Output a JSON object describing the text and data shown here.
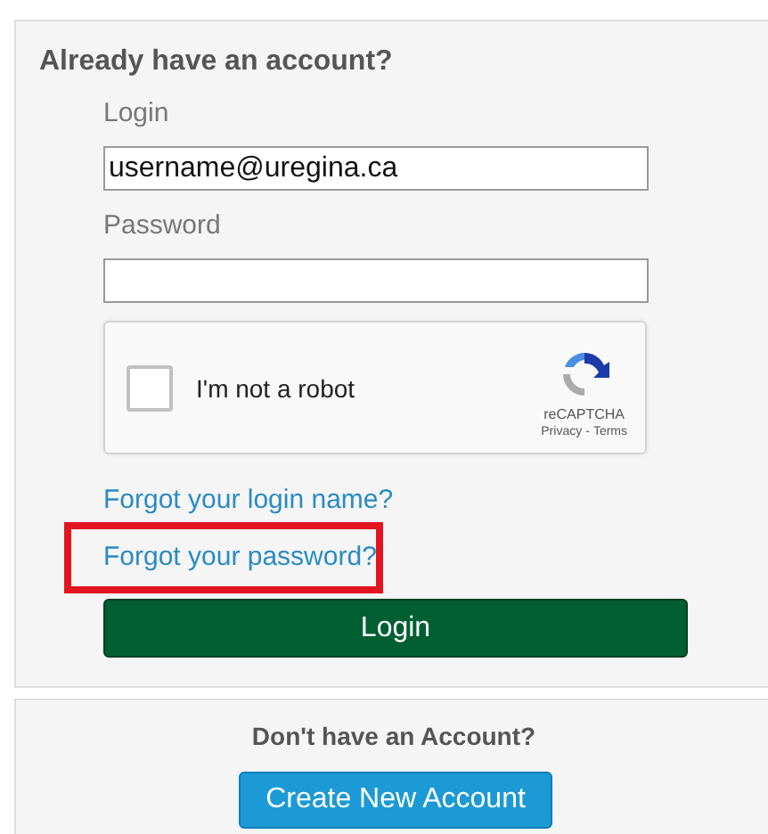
{
  "login_panel": {
    "title": "Already have an account?",
    "login_label": "Login",
    "login_value": "username@uregina.ca",
    "password_label": "Password",
    "captcha": {
      "checked": false,
      "label": "I'm not a robot",
      "brand": "reCAPTCHA",
      "privacy": "Privacy",
      "separator": "-",
      "terms": "Terms"
    },
    "links": [
      {
        "text": "Forgot your login name?",
        "highlighted": false
      },
      {
        "text": "Forgot your password?",
        "highlighted": true
      }
    ],
    "submit": "Login"
  },
  "signup_panel": {
    "title": "Don't have an Account?",
    "button": "Create New Account"
  }
}
